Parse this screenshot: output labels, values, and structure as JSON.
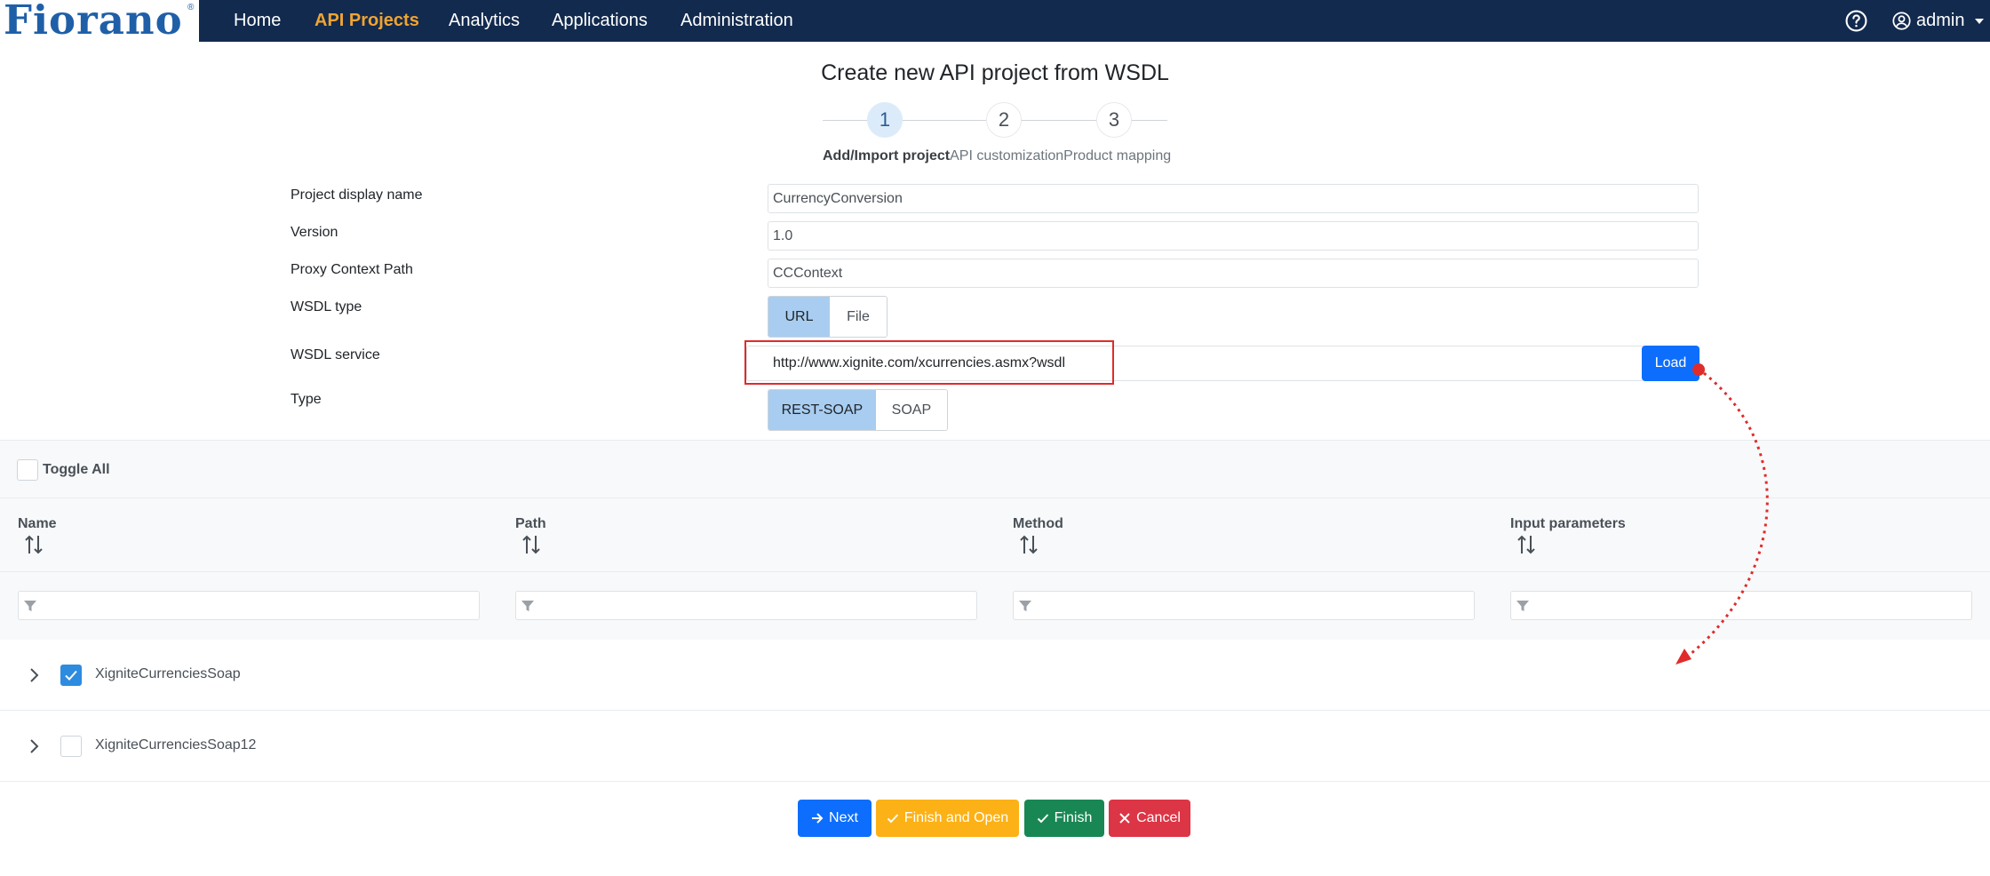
{
  "brand": {
    "logo_text": "Fiorano",
    "reg_mark": "®"
  },
  "nav": {
    "items": [
      {
        "label": "Home"
      },
      {
        "label": "API Projects",
        "active": true
      },
      {
        "label": "Analytics"
      },
      {
        "label": "Applications"
      },
      {
        "label": "Administration"
      }
    ],
    "help_icon": "question-circle-icon",
    "user": {
      "label": "admin",
      "icon": "user-circle-icon"
    }
  },
  "page": {
    "title": "Create new API project from WSDL"
  },
  "stepper": {
    "steps": [
      {
        "number": "1",
        "label": "Add/Import project",
        "active": true
      },
      {
        "number": "2",
        "label": "API customization"
      },
      {
        "number": "3",
        "label": "Product mapping"
      }
    ]
  },
  "form": {
    "project_name": {
      "label": "Project display name",
      "value": "CurrencyConversion"
    },
    "version": {
      "label": "Version",
      "value": "1.0"
    },
    "context_path": {
      "label": "Proxy Context Path",
      "value": "CCContext"
    },
    "wsdl_type": {
      "label": "WSDL type",
      "options": [
        "URL",
        "File"
      ],
      "selected": "URL"
    },
    "wsdl_service": {
      "label": "WSDL service",
      "value": "http://www.xignite.com/xcurrencies.asmx?wsdl",
      "load_label": "Load"
    },
    "type": {
      "label": "Type",
      "options": [
        "REST-SOAP",
        "SOAP"
      ],
      "selected": "REST-SOAP"
    }
  },
  "table": {
    "toggle_all_label": "Toggle All",
    "columns": [
      "Name",
      "Path",
      "Method",
      "Input parameters"
    ],
    "rows": [
      {
        "name": "XigniteCurrenciesSoap",
        "checked": true
      },
      {
        "name": "XigniteCurrenciesSoap12",
        "checked": false
      }
    ]
  },
  "footer": {
    "next_label": "Next",
    "finish_open_label": "Finish and Open",
    "finish_label": "Finish",
    "cancel_label": "Cancel"
  },
  "colors": {
    "nav_bg": "#122a4e",
    "nav_active": "#f0a431",
    "primary": "#0d6efd",
    "warning": "#fcb116",
    "success": "#198754",
    "danger": "#dc3545",
    "highlight": "#e02b2b"
  }
}
